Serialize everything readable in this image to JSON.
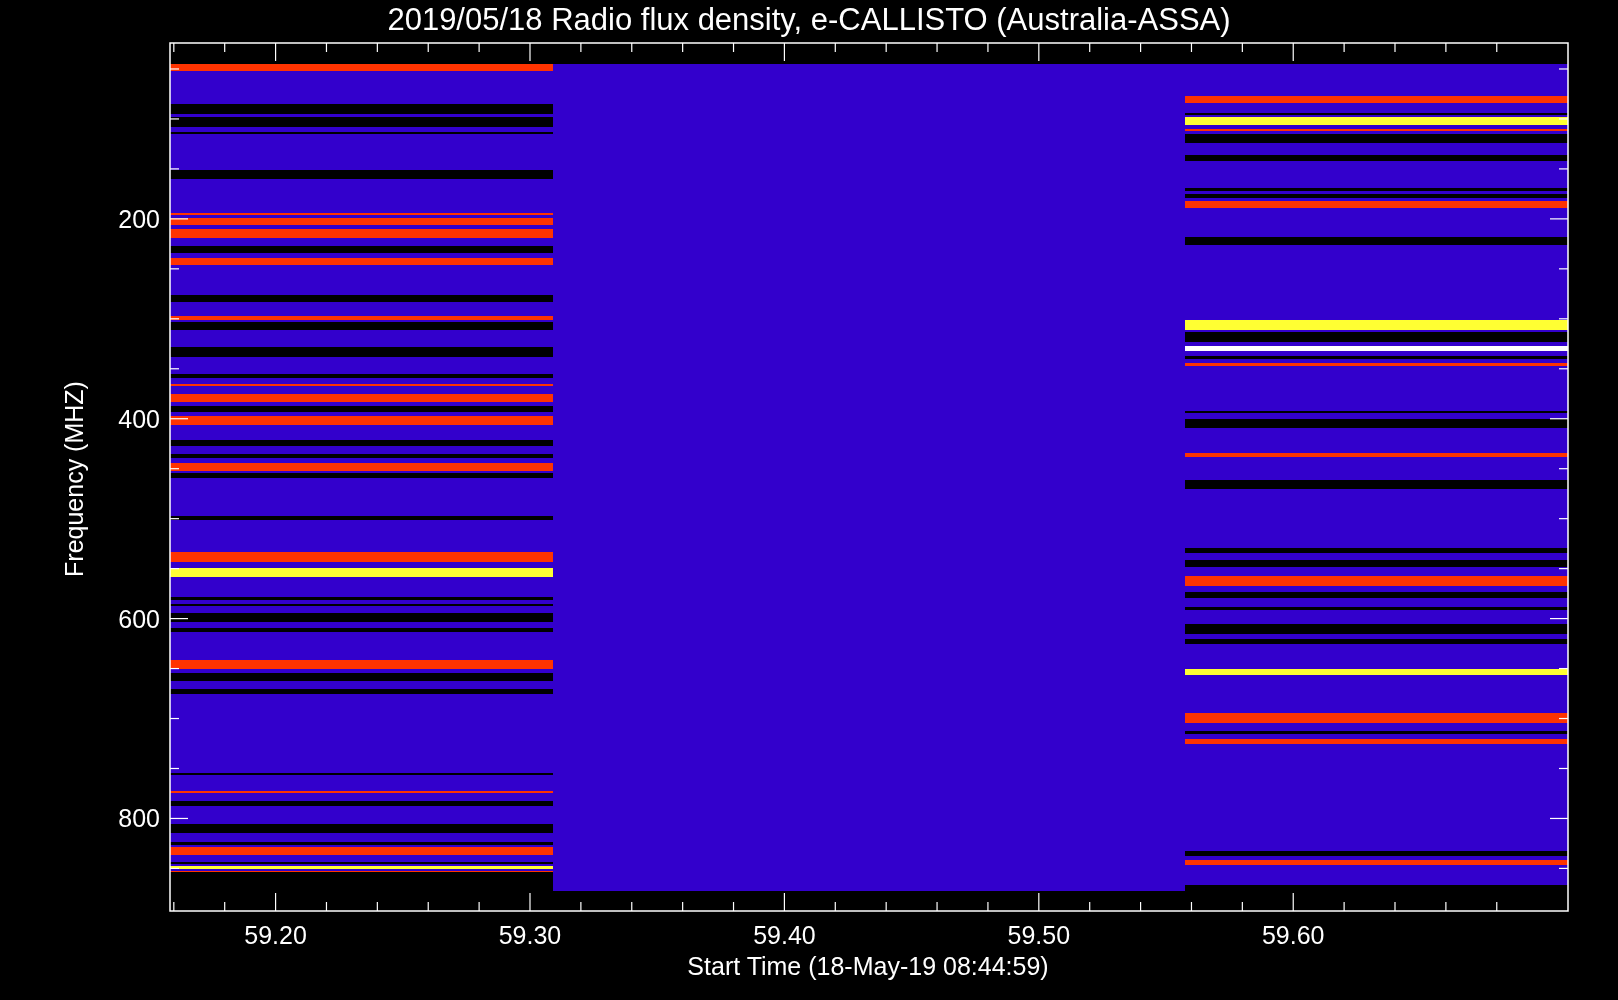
{
  "plot": {
    "title": "2019/05/18  Radio flux density, e-CALLISTO (Australia-ASSA)",
    "xlabel": "Start Time (18-May-19 08:44:59)",
    "ylabel": "Frequency (MHZ)",
    "xticks": [
      "59.20",
      "59.30",
      "59.40",
      "59.50",
      "59.60"
    ],
    "yticks": [
      "200",
      "400",
      "600",
      "800"
    ]
  }
}
